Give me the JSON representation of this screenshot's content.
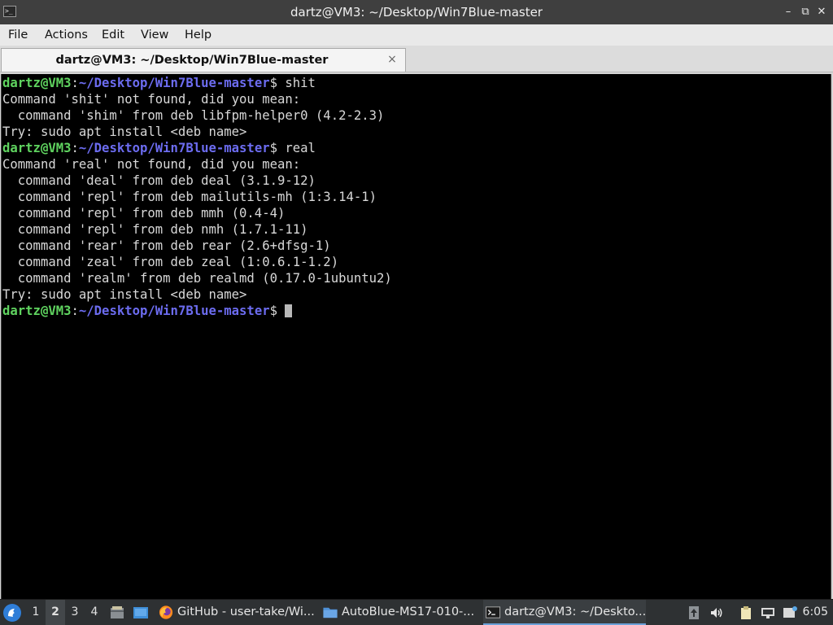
{
  "window": {
    "title": "dartz@VM3: ~/Desktop/Win7Blue-master",
    "buttons": {
      "minimize": "–",
      "restore": "⧉",
      "close": "✕"
    }
  },
  "menu": [
    "File",
    "Actions",
    "Edit",
    "View",
    "Help"
  ],
  "tab": {
    "label": "dartz@VM3: ~/Desktop/Win7Blue-master",
    "close": "×"
  },
  "prompt": {
    "user": "dartz@VM3",
    "colon": ":",
    "path": "~/Desktop/Win7Blue-master",
    "symbol": "$ "
  },
  "terminal": {
    "lines": [
      {
        "type": "prompt",
        "cmd": "shit"
      },
      {
        "type": "out",
        "text": "Command 'shit' not found, did you mean:"
      },
      {
        "type": "out",
        "text": "  command 'shim' from deb libfpm-helper0 (4.2-2.3)"
      },
      {
        "type": "out",
        "text": "Try: sudo apt install <deb name>"
      },
      {
        "type": "prompt",
        "cmd": "real"
      },
      {
        "type": "out",
        "text": "Command 'real' not found, did you mean:"
      },
      {
        "type": "out",
        "text": "  command 'deal' from deb deal (3.1.9-12)"
      },
      {
        "type": "out",
        "text": "  command 'repl' from deb mailutils-mh (1:3.14-1)"
      },
      {
        "type": "out",
        "text": "  command 'repl' from deb mmh (0.4-4)"
      },
      {
        "type": "out",
        "text": "  command 'repl' from deb nmh (1.7.1-11)"
      },
      {
        "type": "out",
        "text": "  command 'rear' from deb rear (2.6+dfsg-1)"
      },
      {
        "type": "out",
        "text": "  command 'zeal' from deb zeal (1:0.6.1-1.2)"
      },
      {
        "type": "out",
        "text": "  command 'realm' from deb realmd (0.17.0-1ubuntu2)"
      },
      {
        "type": "out",
        "text": "Try: sudo apt install <deb name>"
      },
      {
        "type": "prompt",
        "cmd": "",
        "cursor": true
      }
    ]
  },
  "taskbar": {
    "workspaces": [
      "1",
      "2",
      "3",
      "4"
    ],
    "active_workspace": "2",
    "tasks": [
      {
        "label": "GitHub - user-take/Wi...",
        "icon": "firefox-icon"
      },
      {
        "label": "AutoBlue-MS17-010-...",
        "icon": "folder-icon"
      },
      {
        "label": "dartz@VM3: ~/Deskto...",
        "icon": "terminal-icon"
      }
    ],
    "clock": "6:05"
  },
  "colors": {
    "prompt_user": "#5fd35f",
    "prompt_path": "#6c6cf0",
    "terminal_bg": "#000000",
    "taskbar_bg": "#2e3133"
  }
}
